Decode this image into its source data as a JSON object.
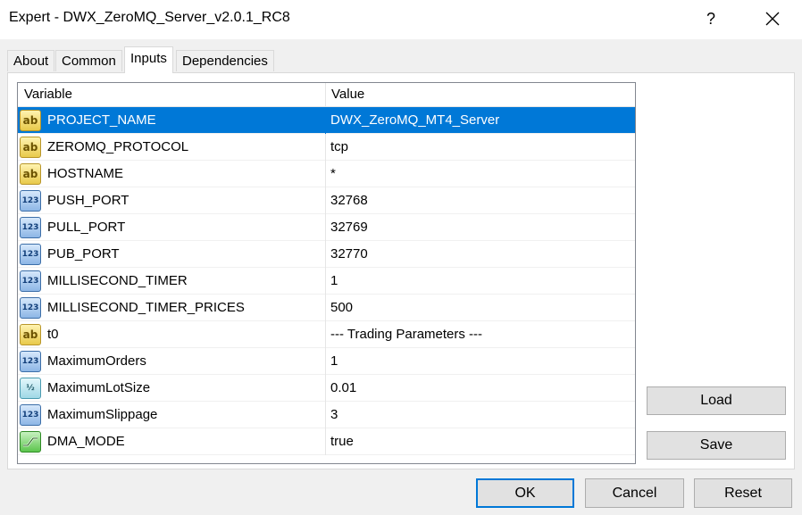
{
  "window": {
    "title": "Expert - DWX_ZeroMQ_Server_v2.0.1_RC8",
    "help_label": "?"
  },
  "tabs": [
    {
      "label": "About"
    },
    {
      "label": "Common"
    },
    {
      "label": "Inputs",
      "active": true
    },
    {
      "label": "Dependencies"
    }
  ],
  "grid": {
    "col_variable": "Variable",
    "col_value": "Value",
    "rows": [
      {
        "type": "string-icon",
        "name": "PROJECT_NAME",
        "value": "DWX_ZeroMQ_MT4_Server",
        "selected": true
      },
      {
        "type": "string-icon",
        "name": "ZEROMQ_PROTOCOL",
        "value": "tcp"
      },
      {
        "type": "string-icon",
        "name": "HOSTNAME",
        "value": "*"
      },
      {
        "type": "integer-icon",
        "name": "PUSH_PORT",
        "value": "32768"
      },
      {
        "type": "integer-icon",
        "name": "PULL_PORT",
        "value": "32769"
      },
      {
        "type": "integer-icon",
        "name": "PUB_PORT",
        "value": "32770"
      },
      {
        "type": "integer-icon",
        "name": "MILLISECOND_TIMER",
        "value": "1"
      },
      {
        "type": "integer-icon",
        "name": "MILLISECOND_TIMER_PRICES",
        "value": "500"
      },
      {
        "type": "string-icon",
        "name": "t0",
        "value": "--- Trading Parameters ---"
      },
      {
        "type": "integer-icon",
        "name": "MaximumOrders",
        "value": "1"
      },
      {
        "type": "double-icon",
        "name": "MaximumLotSize",
        "value": "0.01"
      },
      {
        "type": "integer-icon",
        "name": "MaximumSlippage",
        "value": "3"
      },
      {
        "type": "bool-icon",
        "name": "DMA_MODE",
        "value": "true"
      }
    ]
  },
  "icons": {
    "string": "ab",
    "integer": "123",
    "double": "½"
  },
  "buttons": {
    "load": "Load",
    "save": "Save",
    "ok": "OK",
    "cancel": "Cancel",
    "reset": "Reset"
  },
  "colors": {
    "selection": "#0078d7",
    "default_button_border": "#0078d7"
  }
}
